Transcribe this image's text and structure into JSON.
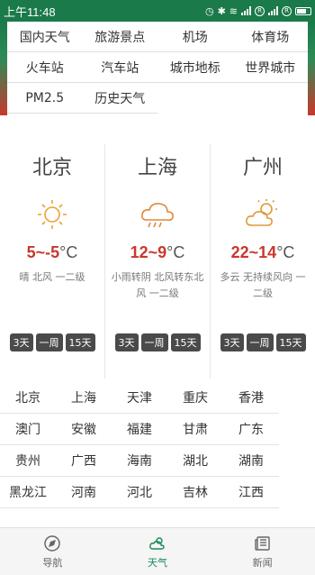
{
  "status_bar": {
    "time": "上午11:48"
  },
  "categories": [
    "国内天气",
    "旅游景点",
    "机场",
    "体育场",
    "火车站",
    "汽车站",
    "城市地标",
    "世界城市",
    "PM2.5",
    "历史天气"
  ],
  "cities": [
    {
      "name": "北京",
      "icon": "sun-icon",
      "temp_high": "5",
      "temp_low": "-5",
      "unit": "°C",
      "desc": "晴 北风 一二级",
      "btn3": "3天",
      "btnW": "一周",
      "btn15": "15天"
    },
    {
      "name": "上海",
      "icon": "rain-cloud-icon",
      "temp_high": "12",
      "temp_low": "9",
      "unit": "°C",
      "desc": "小雨转阴 北风转东北风 一二级",
      "btn3": "3天",
      "btnW": "一周",
      "btn15": "15天"
    },
    {
      "name": "广州",
      "icon": "partly-cloudy-icon",
      "temp_high": "22",
      "temp_low": "14",
      "unit": "°C",
      "desc": "多云 无持续风向 一二级",
      "btn3": "3天",
      "btnW": "一周",
      "btn15": "15天"
    }
  ],
  "provinces": [
    "北京",
    "上海",
    "天津",
    "重庆",
    "香港",
    "澳门",
    "安徽",
    "福建",
    "甘肃",
    "广东",
    "贵州",
    "广西",
    "海南",
    "湖北",
    "湖南",
    "黑龙江",
    "河南",
    "河北",
    "吉林",
    "江西"
  ],
  "nav": {
    "navigation": "导航",
    "weather": "天气",
    "news": "新闻"
  },
  "colors": {
    "accent_green": "#1a8a58",
    "temp_red": "#c8382d",
    "status_bar": "#1a7a4a"
  }
}
